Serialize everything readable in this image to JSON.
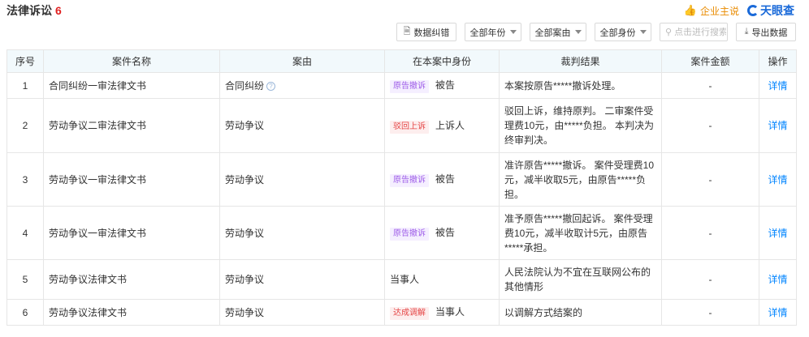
{
  "header": {
    "title": "法律诉讼",
    "count": "6",
    "owner_label": "企业主说",
    "logo_text": "天眼查"
  },
  "toolbar": {
    "correct_label": "数据纠错",
    "year_filter": "全部年份",
    "cause_filter": "全部案由",
    "role_filter": "全部身份",
    "search_placeholder": "点击进行搜索",
    "export_label": "导出数据"
  },
  "table": {
    "headers": [
      "序号",
      "案件名称",
      "案由",
      "在本案中身份",
      "裁判结果",
      "案件金额",
      "操作"
    ],
    "rows": [
      {
        "no": "1",
        "name": "合同纠纷一审法律文书",
        "cause": "合同纠纷",
        "tag": "原告撤诉",
        "role": "被告",
        "result": "本案按原告*****撤诉处理。",
        "amount": "-",
        "action": "详情"
      },
      {
        "no": "2",
        "name": "劳动争议二审法律文书",
        "cause": "劳动争议",
        "tag": "驳回上诉",
        "role": "上诉人",
        "result": "驳回上诉，维持原判。 二审案件受理费10元，由*****负担。 本判决为终审判决。",
        "amount": "-",
        "action": "详情"
      },
      {
        "no": "3",
        "name": "劳动争议一审法律文书",
        "cause": "劳动争议",
        "tag": "原告撤诉",
        "role": "被告",
        "result": "准许原告*****撤诉。 案件受理费10元，减半收取5元，由原告*****负担。",
        "amount": "-",
        "action": "详情"
      },
      {
        "no": "4",
        "name": "劳动争议一审法律文书",
        "cause": "劳动争议",
        "tag": "原告撤诉",
        "role": "被告",
        "result": "准予原告*****撤回起诉。 案件受理费10元，减半收取计5元，由原告*****承担。",
        "amount": "-",
        "action": "详情"
      },
      {
        "no": "5",
        "name": "劳动争议法律文书",
        "cause": "劳动争议",
        "tag": "",
        "role": "当事人",
        "result": "人民法院认为不宜在互联网公布的其他情形",
        "amount": "-",
        "action": "详情"
      },
      {
        "no": "6",
        "name": "劳动争议法律文书",
        "cause": "劳动争议",
        "tag": "达成调解",
        "role": "当事人",
        "result": "以调解方式结案的",
        "amount": "-",
        "action": "详情"
      }
    ]
  },
  "colors": {
    "accent": "#0084ff",
    "count_red": "#e02020",
    "header_bg": "#f2f9fc",
    "tag_purple": "#9e5de8",
    "tag_red": "#e54545"
  }
}
